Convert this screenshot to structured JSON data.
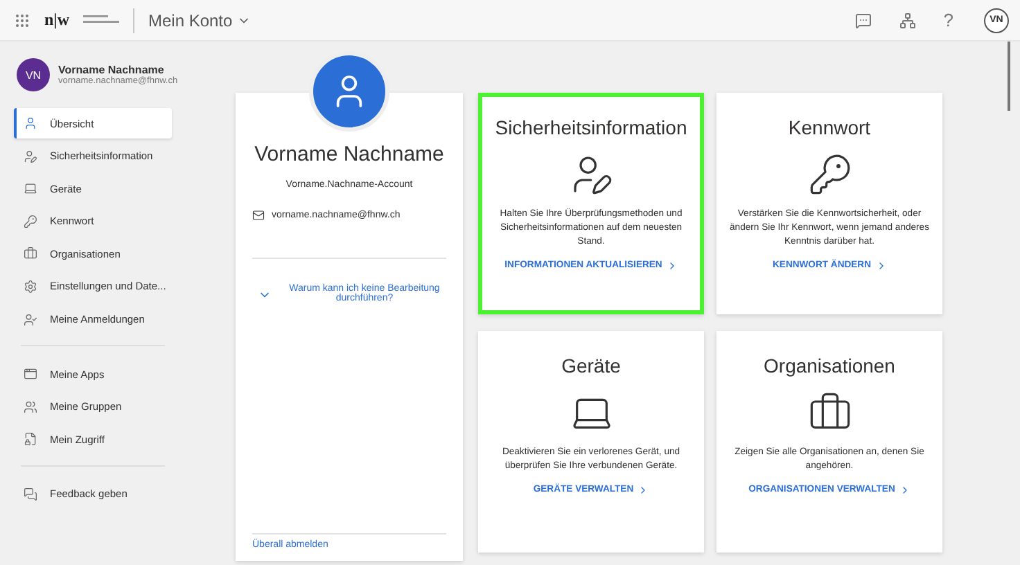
{
  "header": {
    "logo": "n|w",
    "app_title": "Mein Konto",
    "help": "?",
    "avatar": "VN"
  },
  "sidebar": {
    "user": {
      "initials": "VN",
      "name": "Vorname Nachname",
      "email": "vorname.nachname@fhnw.ch"
    },
    "groups": [
      [
        {
          "label": "Übersicht",
          "selected": true
        },
        {
          "label": "Sicherheitsinformation",
          "selected": false
        },
        {
          "label": "Geräte",
          "selected": false
        },
        {
          "label": "Kennwort",
          "selected": false
        },
        {
          "label": "Organisationen",
          "selected": false
        },
        {
          "label": "Einstellungen und Date...",
          "selected": false
        },
        {
          "label": "Meine Anmeldungen",
          "selected": false
        }
      ],
      [
        {
          "label": "Meine Apps",
          "selected": false
        },
        {
          "label": "Meine Gruppen",
          "selected": false
        },
        {
          "label": "Mein Zugriff",
          "selected": false
        }
      ],
      [
        {
          "label": "Feedback geben",
          "selected": false
        }
      ]
    ]
  },
  "profile": {
    "name": "Vorname Nachname",
    "account": "Vorname.Nachname-Account",
    "email": "vorname.nachname@fhnw.ch",
    "edit_question": "Warum kann ich keine Bearbeitung durchführen?",
    "expanded": false,
    "sign_out": "Überall abmelden"
  },
  "tiles": [
    {
      "title": "Sicherheitsinformation",
      "text": "Halten Sie Ihre Überprüfungsmethoden und Sicherheitsinformationen auf dem neuesten Stand.",
      "link": "INFORMATIONEN AKTUALISIEREN",
      "selected": true
    },
    {
      "title": "Kennwort",
      "text": "Verstärken Sie die Kennwortsicherheit, oder ändern Sie Ihr Kennwort, wenn jemand anderes Kenntnis darüber hat.",
      "link": "KENNWORT ÄNDERN",
      "selected": false
    },
    {
      "title": "Geräte",
      "text": "Deaktivieren Sie ein verlorenes Gerät, und überprüfen Sie Ihre verbundenen Geräte.",
      "link": "GERÄTE VERWALTEN",
      "selected": false
    },
    {
      "title": "Organisationen",
      "text": "Zeigen Sie alle Organisationen an, denen Sie angehören.",
      "link": "ORGANISATIONEN VERWALTEN",
      "selected": false
    }
  ]
}
